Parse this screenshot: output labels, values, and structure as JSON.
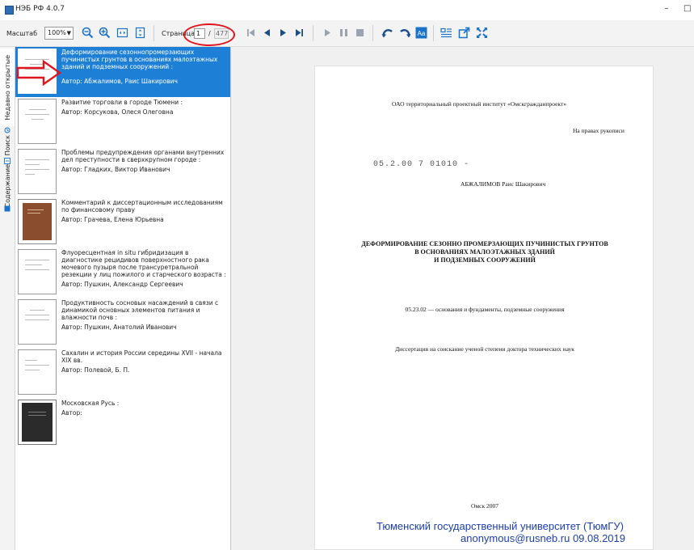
{
  "app": {
    "title": "НЭБ РФ 4.0.7"
  },
  "toolbar": {
    "zoom_label": "Масштаб",
    "zoom_value": "100%",
    "page_label": "Страница",
    "page_current": "1",
    "page_separator": "/",
    "page_total": "477",
    "icons": [
      "zoom-out-icon",
      "zoom-in-icon",
      "fit-width-icon",
      "fit-page-icon",
      "first-page-icon",
      "prev-page-icon",
      "next-page-icon",
      "last-page-icon",
      "play-icon",
      "pause-icon",
      "stop-icon",
      "rotate-left-icon",
      "rotate-right-icon",
      "text-mode-icon",
      "list-mode-icon",
      "external-window-icon",
      "fullscreen-icon"
    ]
  },
  "side_tabs": [
    {
      "label": "Недавно открытые",
      "icon": "history-icon"
    },
    {
      "label": "Поиск",
      "icon": "search-icon"
    },
    {
      "label": "Содержание",
      "icon": "contents-icon"
    }
  ],
  "documents": [
    {
      "title": "Деформирование сезоннопромерзающих пучинистых грунтов в основаниях малоэтажных зданий и подземных сооружений :",
      "author": "Автор: Абжалимов, Раис Шакирович",
      "selected": true,
      "thumb": "text"
    },
    {
      "title": "Развитие торговли в городе Тюмени :",
      "author": "Автор: Корсукова, Олеся Олеговна",
      "selected": false,
      "thumb": "text"
    },
    {
      "title": "Проблемы предупреждения органами внутренних дел преступности в сверхкрупном городе :",
      "author": "Автор: Гладких, Виктор Иванович",
      "selected": false,
      "thumb": "text"
    },
    {
      "title": "Комментарий к диссертационным исследованиям по финансовому праву",
      "author": "Автор: Грачева, Елена Юрьевна",
      "selected": false,
      "thumb": "cover-brown"
    },
    {
      "title": "Флуоресцентная in situ гибридизация в диагностике рецидивов поверхностного рака мочевого пузыря после трансуретральной резекции у лиц пожилого и старческого возраста :",
      "author": "Автор: Пушкин, Александр Сергеевич",
      "selected": false,
      "thumb": "text"
    },
    {
      "title": "Продуктивность сосновых насаждений в связи с динамикой основных элементов питания и влажности почв :",
      "author": "Автор: Пушкин, Анатолий Иванович",
      "selected": false,
      "thumb": "text"
    },
    {
      "title": "Сахалин и история России середины XVII - начала XIX вв.",
      "author": "Автор: Полевой, Б. П.",
      "selected": false,
      "thumb": "text"
    },
    {
      "title": "Московская Русь :",
      "author": "Автор:",
      "selected": false,
      "thumb": "cover-dark"
    }
  ],
  "page": {
    "institute": "ОАО территориальный проектный институт «Омскгражданпроект»",
    "rights": "На правах рукописи",
    "stamp": "05.2.00 7 01010 -",
    "author": "АБЖАЛИМОВ Раис Шакирович",
    "title_line1": "ДЕФОРМИРОВАНИЕ СЕЗОННО ПРОМЕРЗАЮЩИХ ПУЧИНИСТЫХ ГРУНТОВ",
    "title_line2": "В ОСНОВАНИЯХ МАЛОЭТАЖНЫХ ЗДАНИЙ",
    "title_line3": "И ПОДЗЕМНЫХ СООРУЖЕНИЙ",
    "specialty": "05.23.02 — основания и фундаменты, подземные сооружения",
    "degree": "Диссертация на соискание ученой степени доктора технических наук",
    "city_year": "Омск 2007",
    "watermark_line1": "Тюменский государственный университет (ТюмГУ)",
    "watermark_line2": "anonymous@rusneb.ru 09.08.2019"
  },
  "colors": {
    "selection": "#1e7fd6",
    "annotation": "#e0141e",
    "watermark": "#1d3fa8",
    "accent_icon": "#1a73c8"
  }
}
